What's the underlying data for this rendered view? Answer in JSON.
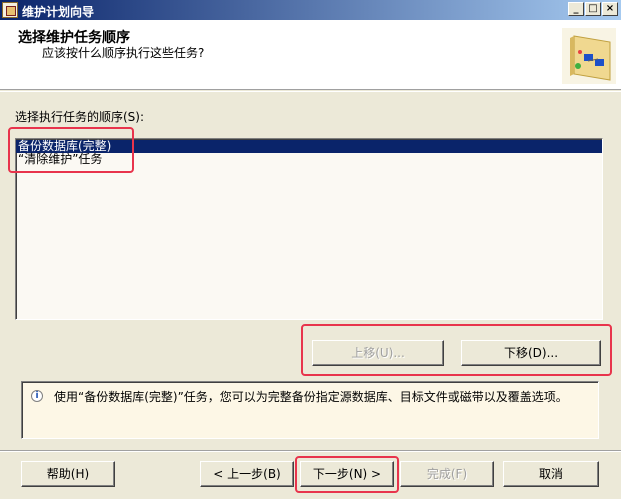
{
  "window": {
    "title": "维护计划向导",
    "minimize": "_",
    "maximize": "□",
    "close": "×"
  },
  "header": {
    "title": "选择维护任务顺序",
    "subtitle": "应该按什么顺序执行这些任务?"
  },
  "order_label": "选择执行任务的顺序(S):",
  "tasks": [
    {
      "label": "备份数据库(完整)",
      "selected": true
    },
    {
      "label": "“清除维护”任务",
      "selected": false
    }
  ],
  "buttons": {
    "move_up": "上移(U)...",
    "move_down": "下移(D)...",
    "help": "帮助(H)",
    "back": "< 上一步(B)",
    "next": "下一步(N) >",
    "finish": "完成(F)",
    "cancel": "取消"
  },
  "info": {
    "icon": "info-icon",
    "text": "使用“备份数据库(完整)”任务，您可以为完整备份指定源数据库、目标文件或磁带以及覆盖选项。"
  },
  "colors": {
    "selection": "#0a246a",
    "highlight": "#e8344c",
    "titlebar": "#0a246a"
  }
}
